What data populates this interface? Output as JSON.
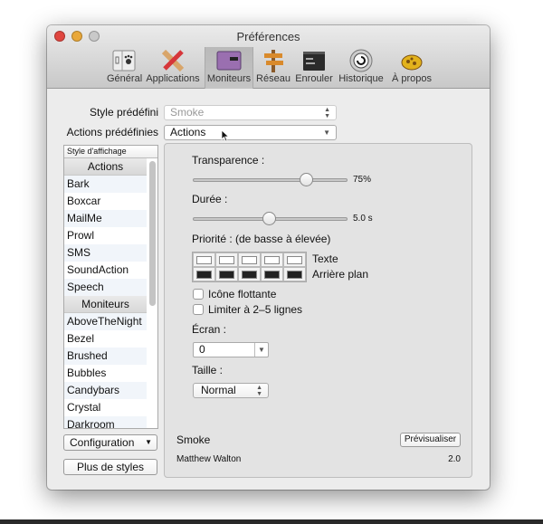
{
  "window": {
    "title": "Préférences"
  },
  "toolbar": {
    "items": [
      {
        "label": "Général",
        "icon": "general-switch-paw-icon"
      },
      {
        "label": "Applications",
        "icon": "ruler-pencil-icon"
      },
      {
        "label": "Moniteurs",
        "icon": "display-window-icon",
        "selected": true
      },
      {
        "label": "Réseau",
        "icon": "signpost-icon"
      },
      {
        "label": "Enrouler",
        "icon": "rollup-window-icon"
      },
      {
        "label": "Historique",
        "icon": "history-icon"
      },
      {
        "label": "À propos",
        "icon": "growl-paw-icon"
      }
    ]
  },
  "presets": {
    "style_label": "Style prédéfini",
    "style_value": "Smoke",
    "actions_label": "Actions prédéfinies",
    "actions_value": "Actions"
  },
  "list": {
    "header": "Style d'affichage",
    "groups": [
      {
        "title": "Actions",
        "items": [
          "Bark",
          "Boxcar",
          "MailMe",
          "Prowl",
          "SMS",
          "SoundAction",
          "Speech"
        ]
      },
      {
        "title": "Moniteurs",
        "items": [
          "AboveTheNight",
          "Bezel",
          "Brushed",
          "Bubbles",
          "Candybars",
          "Crystal",
          "Darkroom"
        ]
      }
    ]
  },
  "buttons": {
    "configuration": "Configuration",
    "more_styles": "Plus de styles",
    "preview": "Prévisualiser"
  },
  "settings": {
    "transparency_label": "Transparence :",
    "transparency_value": "75%",
    "transparency_fraction": 0.73,
    "duration_label": "Durée :",
    "duration_value": "5.0 s",
    "duration_fraction": 0.49,
    "priority_label": "Priorité : (de basse à élevée)",
    "text_label": "Texte",
    "background_label": "Arrière plan",
    "text_colors": [
      "#ffffff",
      "#ffffff",
      "#ffffff",
      "#ffffff",
      "#ffffff"
    ],
    "background_colors": [
      "#222222",
      "#222222",
      "#222222",
      "#222222",
      "#222222"
    ],
    "floating_icon_label": "Icône flottante",
    "floating_icon_checked": false,
    "limit_lines_label": "Limiter à 2–5 lignes",
    "limit_lines_checked": false,
    "screen_label": "Écran :",
    "screen_value": "0",
    "size_label": "Taille :",
    "size_value": "Normal"
  },
  "style_info": {
    "name": "Smoke",
    "author": "Matthew Walton",
    "version": "2.0"
  }
}
